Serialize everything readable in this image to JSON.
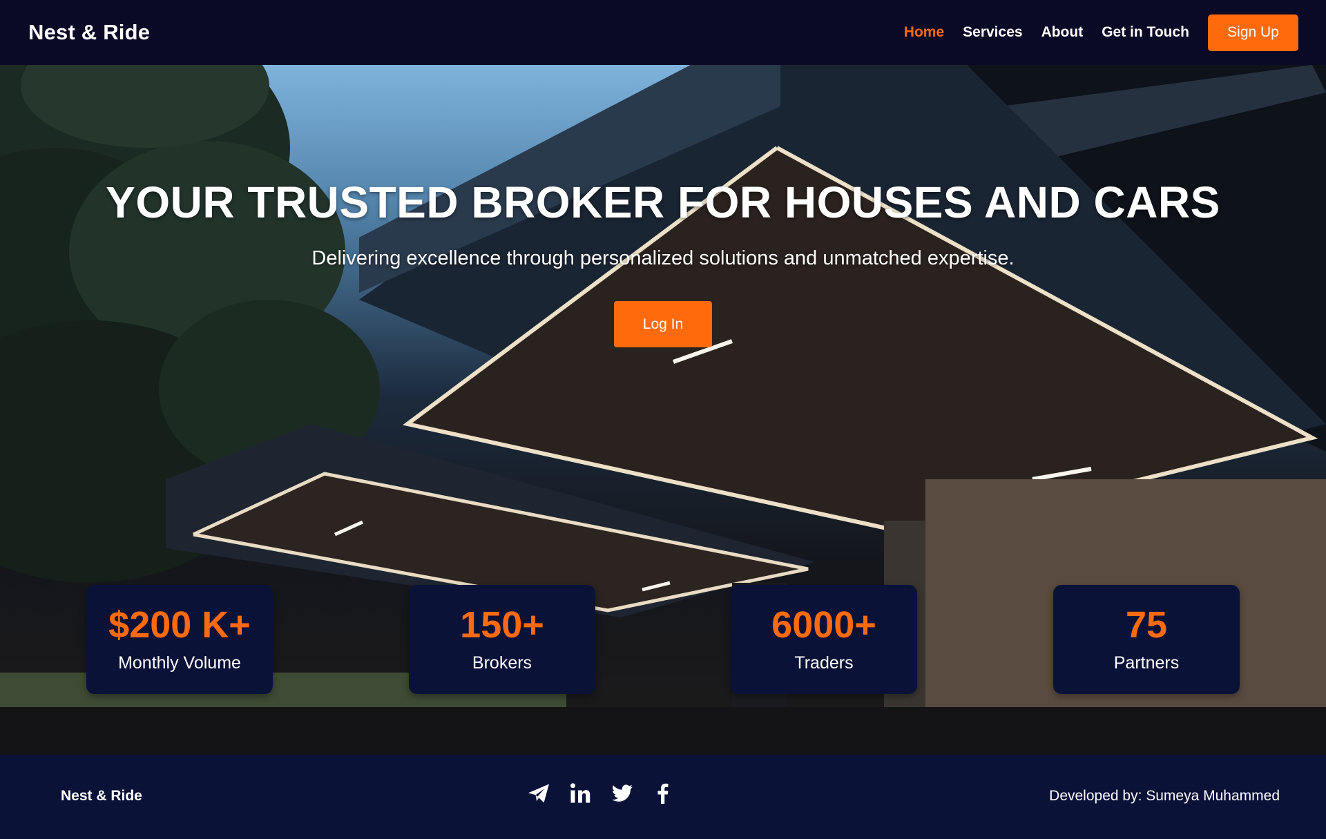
{
  "brand": "Nest & Ride",
  "nav": {
    "links": [
      "Home",
      "Services",
      "About",
      "Get in Touch"
    ],
    "active": "Home",
    "signup_label": "Sign Up"
  },
  "hero": {
    "title": "YOUR TRUSTED BROKER FOR HOUSES AND CARS",
    "subtitle": "Delivering excellence through personalized solutions and unmatched expertise.",
    "login_label": "Log In",
    "background": "modern house carport with LED-lit canopy at dusk"
  },
  "stats": [
    {
      "value": "$200 K+",
      "label": "Monthly Volume"
    },
    {
      "value": "150+",
      "label": "Brokers"
    },
    {
      "value": "6000+",
      "label": "Traders"
    },
    {
      "value": "75",
      "label": "Partners"
    }
  ],
  "footer": {
    "brand": "Nest & Ride",
    "social_icons": [
      "telegram-icon",
      "linkedin-icon",
      "twitter-icon",
      "facebook-icon"
    ],
    "credit": "Developed by: Sumeya Muhammed"
  },
  "colors": {
    "accent": "#ff6a0d",
    "nav_bg": "#0b0a26",
    "card_bg": "#0b1238",
    "footer_bg": "#0b1238"
  }
}
